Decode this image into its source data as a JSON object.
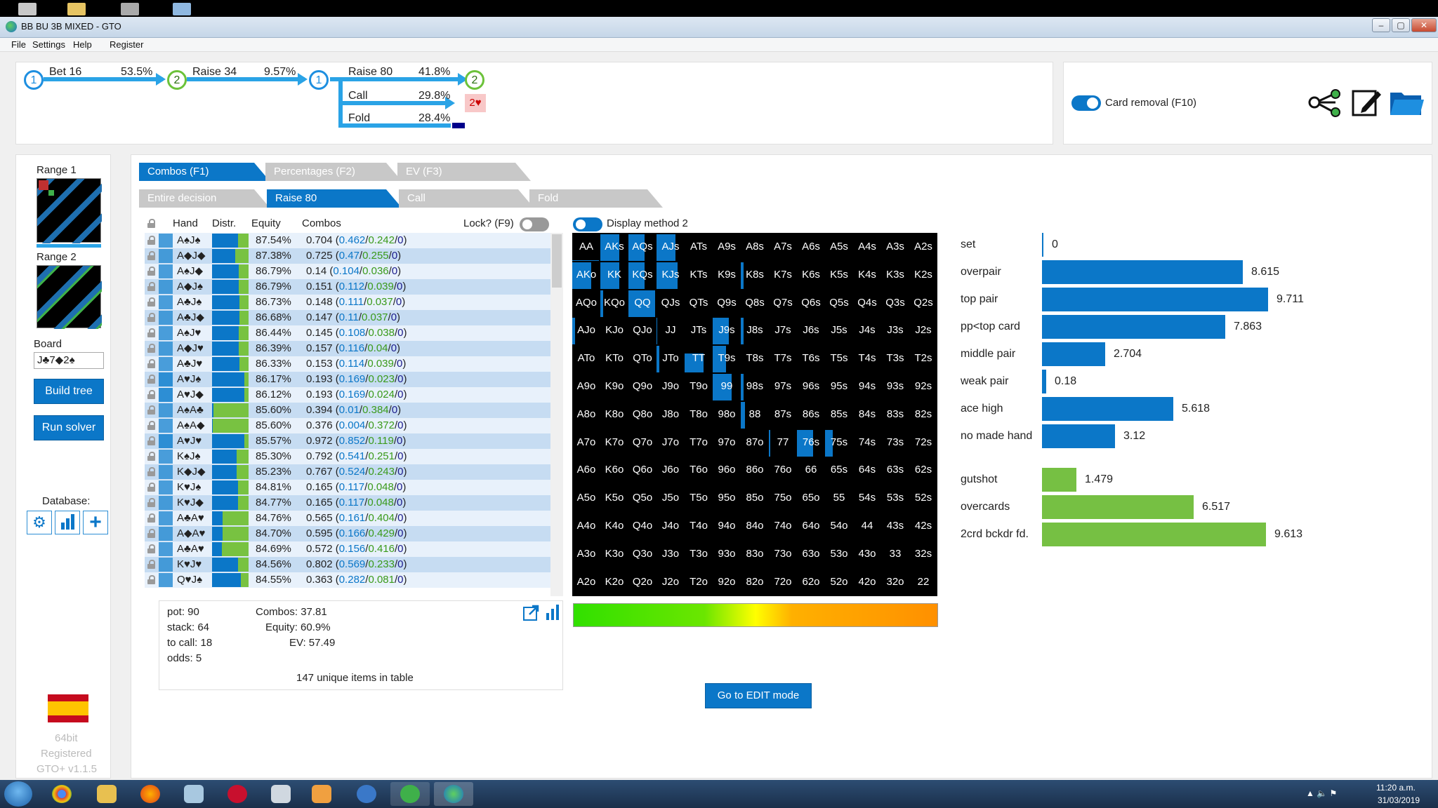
{
  "window": {
    "title": "BB BU 3B MIXED - GTO"
  },
  "menu": [
    "File",
    "Settings",
    "Help",
    "Register"
  ],
  "tree": {
    "n1": "1",
    "n2": "2",
    "n3": "1",
    "n4": "2",
    "bet_label": "Bet 16",
    "bet_pct": "53.5%",
    "raise_label": "Raise 34",
    "raise_pct": "9.57%",
    "raise80_label": "Raise 80",
    "raise80_pct": "41.8%",
    "call_label": "Call",
    "call_pct": "29.8%",
    "fold_label": "Fold",
    "fold_pct": "28.4%",
    "call_badge": "2♥"
  },
  "card_removal": "Card removal (F10)",
  "left": {
    "range1": "Range 1",
    "range2": "Range 2",
    "board_label": "Board",
    "board_value": "J♣7◆2♠",
    "build_tree": "Build tree",
    "run_solver": "Run solver",
    "database": "Database:",
    "version_1": "64bit",
    "version_2": "Registered",
    "version_3": "GTO+ v1.1.5"
  },
  "tabs_top": [
    "Combos (F1)",
    "Percentages (F2)",
    "EV (F3)"
  ],
  "tabs_action": [
    "Entire decision",
    "Raise 80",
    "Call",
    "Fold"
  ],
  "table_headers": {
    "hand": "Hand",
    "distr": "Distr.",
    "equity": "Equity",
    "combos": "Combos",
    "lock": "Lock? (F9)"
  },
  "rows": [
    {
      "hand": "A♠J♠",
      "distr": 0.72,
      "equity": "87.54%",
      "total": "0.704",
      "r": "0.462",
      "c": "0.242",
      "f": "0"
    },
    {
      "hand": "A◆J◆",
      "distr": 0.64,
      "equity": "87.38%",
      "total": "0.725",
      "r": "0.47",
      "c": "0.255",
      "f": "0"
    },
    {
      "hand": "A♠J◆",
      "distr": 0.74,
      "equity": "86.79%",
      "total": "0.14",
      "r": "0.104",
      "c": "0.036",
      "f": "0"
    },
    {
      "hand": "A◆J♠",
      "distr": 0.74,
      "equity": "86.79%",
      "total": "0.151",
      "r": "0.112",
      "c": "0.039",
      "f": "0"
    },
    {
      "hand": "A♣J♠",
      "distr": 0.75,
      "equity": "86.73%",
      "total": "0.148",
      "r": "0.111",
      "c": "0.037",
      "f": "0"
    },
    {
      "hand": "A♣J◆",
      "distr": 0.75,
      "equity": "86.68%",
      "total": "0.147",
      "r": "0.11",
      "c": "0.037",
      "f": "0"
    },
    {
      "hand": "A♠J♥",
      "distr": 0.74,
      "equity": "86.44%",
      "total": "0.145",
      "r": "0.108",
      "c": "0.038",
      "f": "0"
    },
    {
      "hand": "A◆J♥",
      "distr": 0.74,
      "equity": "86.39%",
      "total": "0.157",
      "r": "0.116",
      "c": "0.04",
      "f": "0"
    },
    {
      "hand": "A♣J♥",
      "distr": 0.75,
      "equity": "86.33%",
      "total": "0.153",
      "r": "0.114",
      "c": "0.039",
      "f": "0"
    },
    {
      "hand": "A♥J♠",
      "distr": 0.88,
      "equity": "86.17%",
      "total": "0.193",
      "r": "0.169",
      "c": "0.023",
      "f": "0"
    },
    {
      "hand": "A♥J◆",
      "distr": 0.88,
      "equity": "86.12%",
      "total": "0.193",
      "r": "0.169",
      "c": "0.024",
      "f": "0"
    },
    {
      "hand": "A♠A♣",
      "distr": 0.03,
      "equity": "85.60%",
      "total": "0.394",
      "r": "0.01",
      "c": "0.384",
      "f": "0"
    },
    {
      "hand": "A♠A◆",
      "distr": 0.01,
      "equity": "85.60%",
      "total": "0.376",
      "r": "0.004",
      "c": "0.372",
      "f": "0"
    },
    {
      "hand": "A♥J♥",
      "distr": 0.88,
      "equity": "85.57%",
      "total": "0.972",
      "r": "0.852",
      "c": "0.119",
      "f": "0"
    },
    {
      "hand": "K♠J♠",
      "distr": 0.68,
      "equity": "85.30%",
      "total": "0.792",
      "r": "0.541",
      "c": "0.251",
      "f": "0"
    },
    {
      "hand": "K◆J◆",
      "distr": 0.68,
      "equity": "85.23%",
      "total": "0.767",
      "r": "0.524",
      "c": "0.243",
      "f": "0"
    },
    {
      "hand": "K♥J♠",
      "distr": 0.71,
      "equity": "84.81%",
      "total": "0.165",
      "r": "0.117",
      "c": "0.048",
      "f": "0"
    },
    {
      "hand": "K♥J◆",
      "distr": 0.71,
      "equity": "84.77%",
      "total": "0.165",
      "r": "0.117",
      "c": "0.048",
      "f": "0"
    },
    {
      "hand": "A♣A♥",
      "distr": 0.28,
      "equity": "84.76%",
      "total": "0.565",
      "r": "0.161",
      "c": "0.404",
      "f": "0"
    },
    {
      "hand": "A◆A♥",
      "distr": 0.28,
      "equity": "84.70%",
      "total": "0.595",
      "r": "0.166",
      "c": "0.429",
      "f": "0"
    },
    {
      "hand": "A♣A♥",
      "distr": 0.27,
      "equity": "84.69%",
      "total": "0.572",
      "r": "0.156",
      "c": "0.416",
      "f": "0"
    },
    {
      "hand": "K♥J♥",
      "distr": 0.71,
      "equity": "84.56%",
      "total": "0.802",
      "r": "0.569",
      "c": "0.233",
      "f": "0"
    },
    {
      "hand": "Q♥J♠",
      "distr": 0.78,
      "equity": "84.55%",
      "total": "0.363",
      "r": "0.282",
      "c": "0.081",
      "f": "0"
    }
  ],
  "summary": {
    "pot": "pot: 90",
    "stack": "stack: 64",
    "to_call": "to call: 18",
    "odds": "odds: 5",
    "combos": "Combos: 37.81",
    "equity": "Equity: 60.9%",
    "ev": "EV: 57.49",
    "unique": "147 unique items in table"
  },
  "display_method": "Display method 2",
  "grid": {
    "labels": [
      [
        "AA",
        "AKs",
        "AQs",
        "AJs",
        "ATs",
        "A9s",
        "A8s",
        "A7s",
        "A6s",
        "A5s",
        "A4s",
        "A3s",
        "A2s"
      ],
      [
        "AKo",
        "KK",
        "KQs",
        "KJs",
        "KTs",
        "K9s",
        "K8s",
        "K7s",
        "K6s",
        "K5s",
        "K4s",
        "K3s",
        "K2s"
      ],
      [
        "AQo",
        "KQo",
        "QQ",
        "QJs",
        "QTs",
        "Q9s",
        "Q8s",
        "Q7s",
        "Q6s",
        "Q5s",
        "Q4s",
        "Q3s",
        "Q2s"
      ],
      [
        "AJo",
        "KJo",
        "QJo",
        "JJ",
        "JTs",
        "J9s",
        "J8s",
        "J7s",
        "J6s",
        "J5s",
        "J4s",
        "J3s",
        "J2s"
      ],
      [
        "ATo",
        "KTo",
        "QTo",
        "JTo",
        "TT",
        "T9s",
        "T8s",
        "T7s",
        "T6s",
        "T5s",
        "T4s",
        "T3s",
        "T2s"
      ],
      [
        "A9o",
        "K9o",
        "Q9o",
        "J9o",
        "T9o",
        "99",
        "98s",
        "97s",
        "96s",
        "95s",
        "94s",
        "93s",
        "92s"
      ],
      [
        "A8o",
        "K8o",
        "Q8o",
        "J8o",
        "T8o",
        "98o",
        "88",
        "87s",
        "86s",
        "85s",
        "84s",
        "83s",
        "82s"
      ],
      [
        "A7o",
        "K7o",
        "Q7o",
        "J7o",
        "T7o",
        "97o",
        "87o",
        "77",
        "76s",
        "75s",
        "74s",
        "73s",
        "72s"
      ],
      [
        "A6o",
        "K6o",
        "Q6o",
        "J6o",
        "T6o",
        "96o",
        "86o",
        "76o",
        "66",
        "65s",
        "64s",
        "63s",
        "62s"
      ],
      [
        "A5o",
        "K5o",
        "Q5o",
        "J5o",
        "T5o",
        "95o",
        "85o",
        "75o",
        "65o",
        "55",
        "54s",
        "53s",
        "52s"
      ],
      [
        "A4o",
        "K4o",
        "Q4o",
        "J4o",
        "T4o",
        "94o",
        "84o",
        "74o",
        "64o",
        "54o",
        "44",
        "43s",
        "42s"
      ],
      [
        "A3o",
        "K3o",
        "Q3o",
        "J3o",
        "T3o",
        "93o",
        "83o",
        "73o",
        "63o",
        "53o",
        "43o",
        "33",
        "32s"
      ],
      [
        "A2o",
        "K2o",
        "Q2o",
        "J2o",
        "T2o",
        "92o",
        "82o",
        "72o",
        "62o",
        "52o",
        "42o",
        "32o",
        "22"
      ]
    ],
    "fills": {
      "0,0": [
        1,
        0.03
      ],
      "0,1": [
        0.7,
        1
      ],
      "0,2": [
        0.6,
        1
      ],
      "0,3": [
        0.7,
        1
      ],
      "1,0": [
        0.7,
        1
      ],
      "1,1": [
        0.7,
        1
      ],
      "1,2": [
        0.6,
        1
      ],
      "1,3": [
        0.8,
        1
      ],
      "1,6": [
        0.1,
        1
      ],
      "2,1": [
        0.1,
        1
      ],
      "2,2": [
        1,
        1
      ],
      "3,0": [
        0.1,
        1
      ],
      "3,3": [
        0.03,
        1
      ],
      "3,5": [
        0.6,
        1
      ],
      "3,6": [
        0.1,
        1
      ],
      "4,3": [
        0.1,
        1
      ],
      "4,4": [
        0.7,
        0.7
      ],
      "4,5": [
        0.5,
        1
      ],
      "5,5": [
        0.7,
        1
      ],
      "5,6": [
        0.1,
        1
      ],
      "6,6": [
        0.15,
        1
      ],
      "7,7": [
        0.05,
        1
      ],
      "7,8": [
        0.6,
        1
      ],
      "7,9": [
        0.3,
        1
      ]
    }
  },
  "edit_button": "Go to EDIT mode",
  "categories": [
    {
      "label": "set",
      "value": "0",
      "v": 0,
      "color": "#0b77c8"
    },
    {
      "label": "overpair",
      "value": "8.615",
      "v": 8.615,
      "color": "#0b77c8"
    },
    {
      "label": "top pair",
      "value": "9.711",
      "v": 9.711,
      "color": "#0b77c8"
    },
    {
      "label": "pp<top card",
      "value": "7.863",
      "v": 7.863,
      "color": "#0b77c8"
    },
    {
      "label": "middle pair",
      "value": "2.704",
      "v": 2.704,
      "color": "#0b77c8"
    },
    {
      "label": "weak pair",
      "value": "0.18",
      "v": 0.18,
      "color": "#0b77c8"
    },
    {
      "label": "ace high",
      "value": "5.618",
      "v": 5.618,
      "color": "#0b77c8"
    },
    {
      "label": "no made hand",
      "value": "3.12",
      "v": 3.12,
      "color": "#0b77c8"
    },
    {
      "label": "gutshot",
      "value": "1.479",
      "v": 1.479,
      "color": "#76c043"
    },
    {
      "label": "overcards",
      "value": "6.517",
      "v": 6.517,
      "color": "#76c043"
    },
    {
      "label": "2crd bckdr fd.",
      "value": "9.613",
      "v": 9.613,
      "color": "#76c043"
    }
  ],
  "clock": {
    "time": "11:20 a.m.",
    "date": "31/03/2019"
  }
}
